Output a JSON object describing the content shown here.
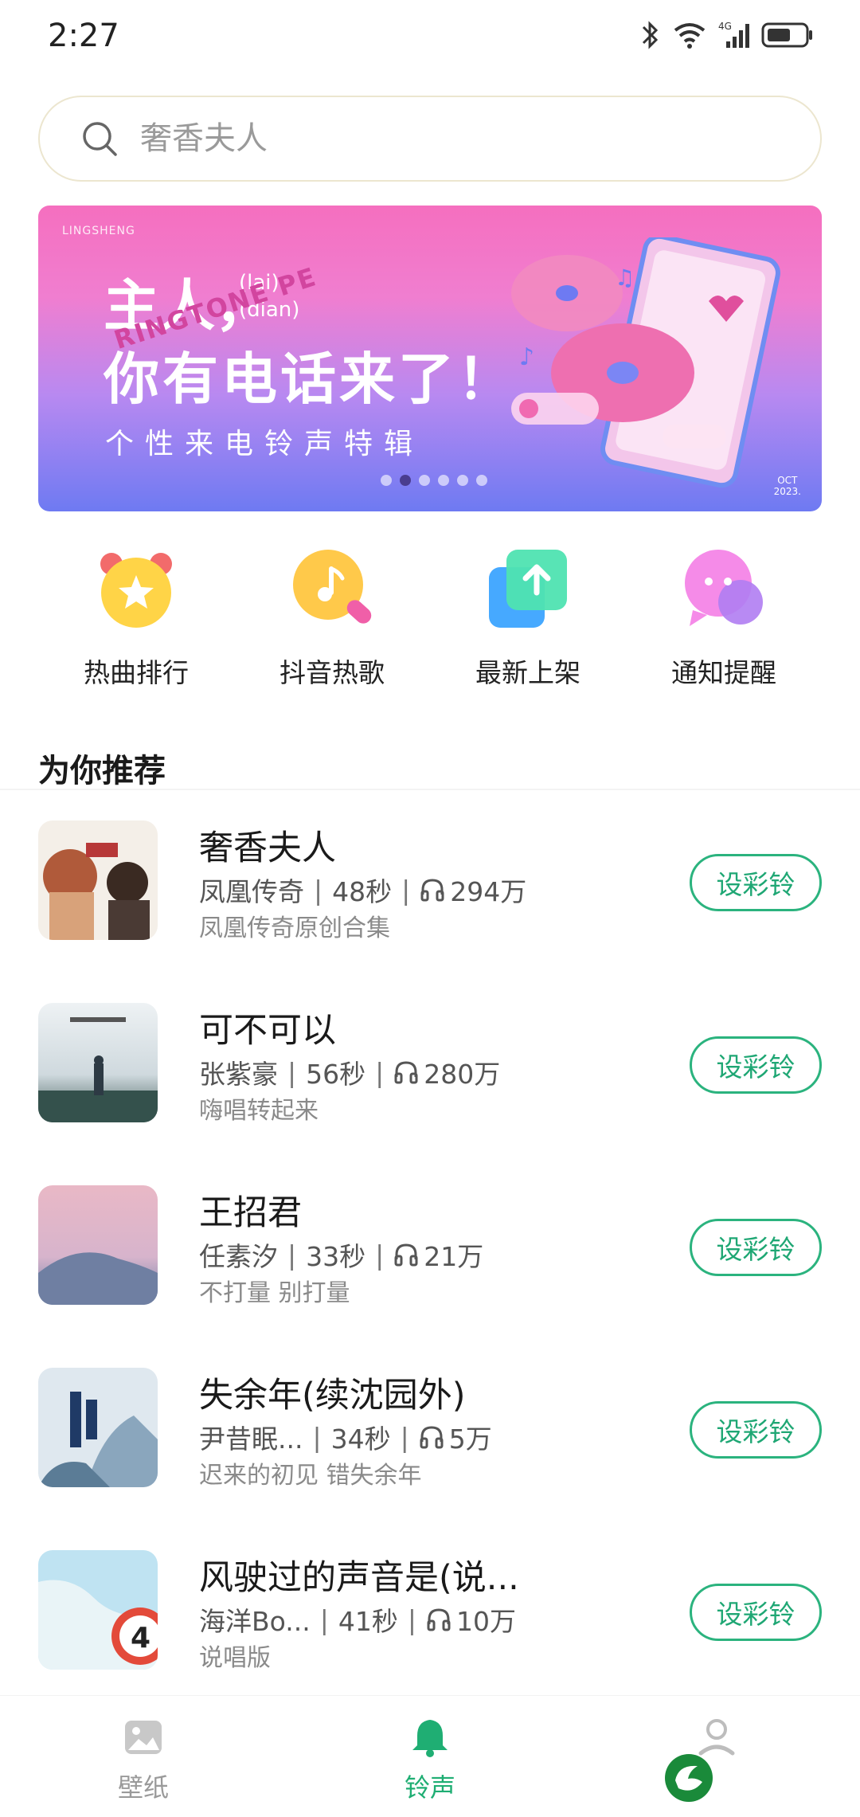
{
  "status_bar": {
    "time": "2:27",
    "network": "4G"
  },
  "search": {
    "placeholder": "奢香夫人"
  },
  "banner": {
    "brand": "LINGSHENG",
    "line1": "主人，",
    "pinyin_top": "(lai)",
    "pinyin_bottom": "(dian)",
    "line2": "你有电话来了！",
    "curve_text": "RINGTONE PE",
    "line3": "个性来电铃声特辑",
    "date_top": "OCT",
    "date_bottom": "2023.",
    "dots_total": 6,
    "dots_active": 2
  },
  "quick_entries": [
    {
      "label": "热曲排行",
      "icon": "star-alarm-icon"
    },
    {
      "label": "抖音热歌",
      "icon": "music-search-icon"
    },
    {
      "label": "最新上架",
      "icon": "upload-arrow-icon"
    },
    {
      "label": "通知提醒",
      "icon": "chat-bubble-icon"
    }
  ],
  "section": {
    "title": "为你推荐"
  },
  "songs": [
    {
      "title": "奢香夫人",
      "artist": "凤凰传奇",
      "duration": "48秒",
      "plays": "294万",
      "subtitle": "凤凰传奇原创合集",
      "button": "设彩铃"
    },
    {
      "title": "可不可以",
      "artist": "张紫豪",
      "duration": "56秒",
      "plays": "280万",
      "subtitle": "嗨唱转起来",
      "button": "设彩铃"
    },
    {
      "title": "王招君",
      "artist": "任素汐",
      "duration": "33秒",
      "plays": "21万",
      "subtitle": "不打量 别打量",
      "button": "设彩铃"
    },
    {
      "title": "失余年(续沈园外)",
      "artist": "尹昔眠...",
      "duration": "34秒",
      "plays": "5万",
      "subtitle": "迟来的初见 错失余年",
      "button": "设彩铃"
    },
    {
      "title": "风驶过的声音是(说...",
      "artist": "海洋Bo...",
      "duration": "41秒",
      "plays": "10万",
      "subtitle": "说唱版",
      "button": "设彩铃"
    }
  ],
  "bottom_nav": {
    "wallpaper": "壁纸",
    "ringtone": "铃声"
  },
  "colors": {
    "accent": "#1fae73"
  }
}
